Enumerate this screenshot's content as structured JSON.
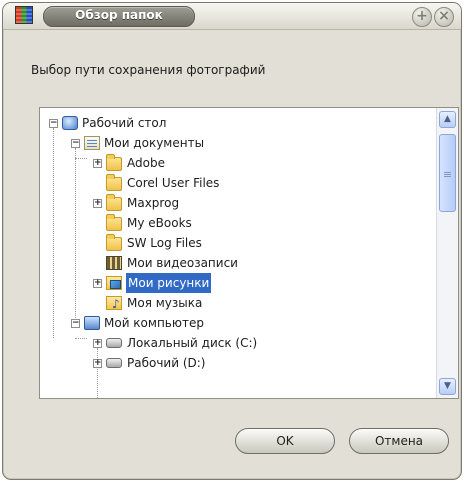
{
  "window": {
    "title": "Обзор папок",
    "description": "Выбор пути сохранения фотографий"
  },
  "titlebar_buttons": {
    "plus_symbol": "+",
    "close_symbol": "×"
  },
  "tree": {
    "items": [
      {
        "label": "Рабочий стол",
        "icon": "desktop-icon",
        "expander": "minus"
      },
      {
        "label": "Мои документы",
        "icon": "my-documents-icon",
        "expander": "minus"
      },
      {
        "label": "Adobe",
        "icon": "folder-icon",
        "expander": "plus"
      },
      {
        "label": "Corel User Files",
        "icon": "folder-icon",
        "expander": ""
      },
      {
        "label": "Maxprog",
        "icon": "folder-icon",
        "expander": "plus"
      },
      {
        "label": "My eBooks",
        "icon": "folder-icon",
        "expander": ""
      },
      {
        "label": "SW Log Files",
        "icon": "folder-icon",
        "expander": ""
      },
      {
        "label": "Мои видеозаписи",
        "icon": "videos-folder-icon",
        "expander": ""
      },
      {
        "label": "Мои рисунки",
        "icon": "pictures-folder-icon",
        "expander": "plus",
        "selected": true
      },
      {
        "label": "Моя музыка",
        "icon": "music-folder-icon",
        "expander": ""
      },
      {
        "label": "Мой компьютер",
        "icon": "my-computer-icon",
        "expander": "minus"
      },
      {
        "label": "Локальный диск (C:)",
        "icon": "drive-icon",
        "expander": "plus"
      },
      {
        "label": "Рабочий (D:)",
        "icon": "drive-icon",
        "expander": "plus"
      }
    ]
  },
  "scrollbar": {
    "up_arrow": "▲",
    "down_arrow": "▼"
  },
  "buttons": {
    "ok": "OK",
    "cancel": "Отмена"
  },
  "expander_symbols": {
    "plus": "+",
    "minus": "−"
  }
}
